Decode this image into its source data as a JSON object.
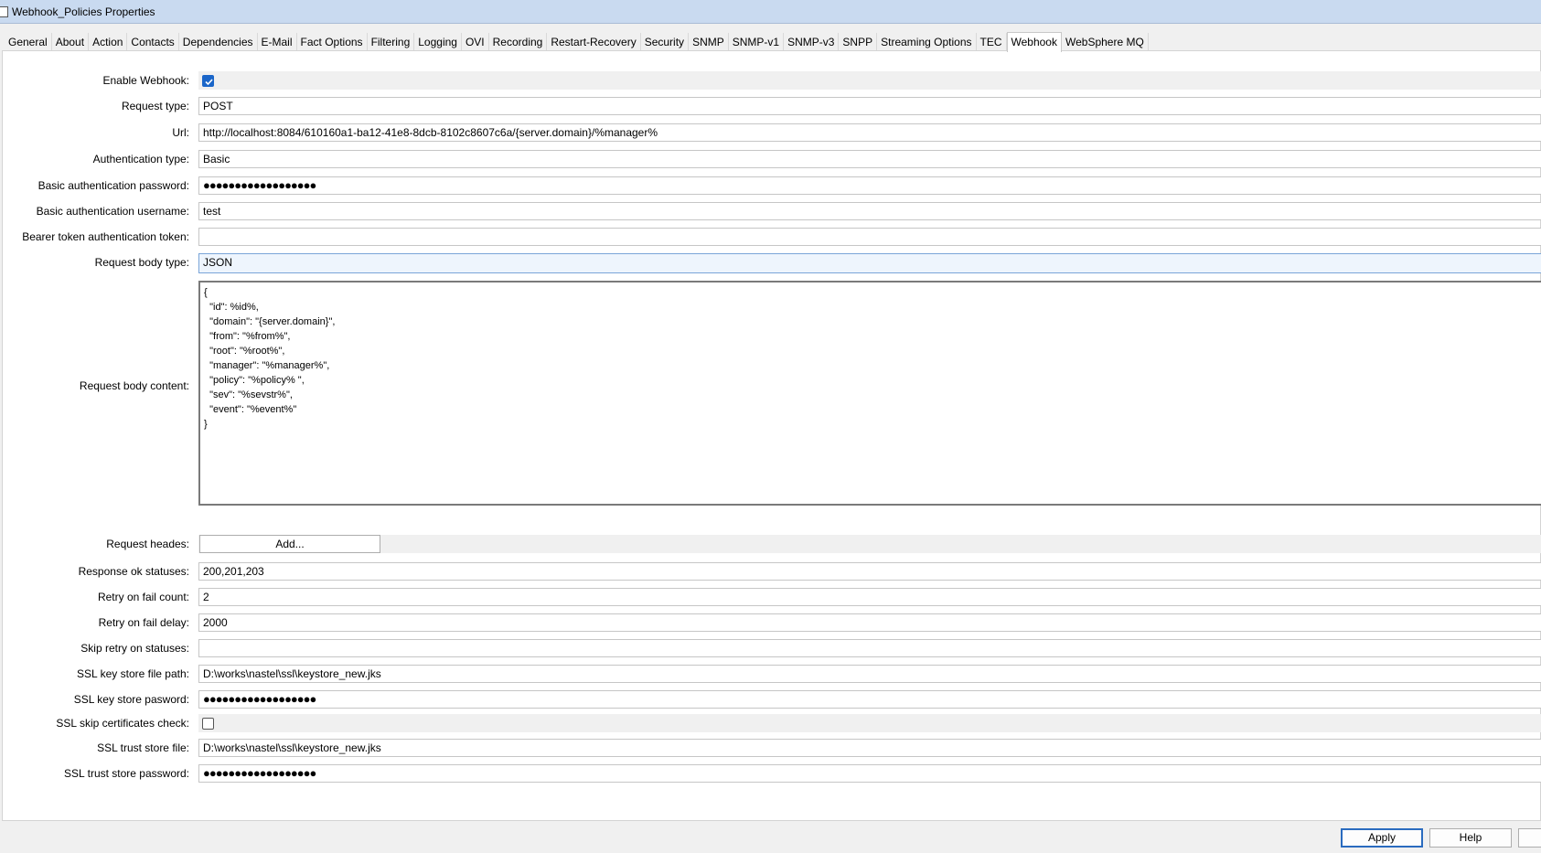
{
  "window": {
    "title": "Webhook_Policies Properties"
  },
  "tabs": [
    "General",
    "About",
    "Action",
    "Contacts",
    "Dependencies",
    "E-Mail",
    "Fact Options",
    "Filtering",
    "Logging",
    "OVI",
    "Recording",
    "Restart-Recovery",
    "Security",
    "SNMP",
    "SNMP-v1",
    "SNMP-v3",
    "SNPP",
    "Streaming Options",
    "TEC",
    "Webhook",
    "WebSphere MQ"
  ],
  "active_tab": "Webhook",
  "form": {
    "enable_webhook": {
      "label": "Enable Webhook:",
      "checked": true
    },
    "request_type": {
      "label": "Request type:",
      "value": "POST"
    },
    "url": {
      "label": "Url:",
      "value": "http://localhost:8084/610160a1-ba12-41e8-8dcb-8102c8607c6a/{server.domain}/%manager%"
    },
    "auth_type": {
      "label": "Authentication type:",
      "value": "Basic"
    },
    "basic_password": {
      "label": "Basic authentication password:",
      "value": "●●●●●●●●●●●●●●●●●●"
    },
    "basic_username": {
      "label": "Basic authentication username:",
      "value": "test"
    },
    "bearer_token": {
      "label": "Bearer token authentication token:",
      "value": ""
    },
    "body_type": {
      "label": "Request body  type:",
      "value": "JSON"
    },
    "body_content": {
      "label": "Request body content:",
      "value": "{\n  \"id\": %id%,\n  \"domain\": \"{server.domain}\",\n  \"from\": \"%from%\",\n  \"root\": \"%root%\",\n  \"manager\": \"%manager%\",\n  \"policy\": \"%policy% \",\n  \"sev\": \"%sevstr%\",\n  \"event\": \"%event%\"\n}"
    },
    "request_headers": {
      "label": "Request heades:",
      "button": "Add..."
    },
    "ok_statuses": {
      "label": "Response ok statuses:",
      "value": "200,201,203"
    },
    "retry_count": {
      "label": "Retry on fail count:",
      "value": "2"
    },
    "retry_delay": {
      "label": "Retry on fail delay:",
      "value": "2000"
    },
    "skip_retry": {
      "label": "Skip retry on statuses:",
      "value": ""
    },
    "ssl_keystore_path": {
      "label": "SSL key store file path:",
      "value": "D:\\works\\nastel\\ssl\\keystore_new.jks"
    },
    "ssl_keystore_password": {
      "label": "SSL key store pasword:",
      "value": "●●●●●●●●●●●●●●●●●●"
    },
    "ssl_skip_check": {
      "label": "SSL skip certificates check:",
      "checked": false
    },
    "ssl_truststore_file": {
      "label": "SSL trust store file:",
      "value": "D:\\works\\nastel\\ssl\\keystore_new.jks"
    },
    "ssl_truststore_password": {
      "label": "SSL trust store password:",
      "value": "●●●●●●●●●●●●●●●●●●"
    }
  },
  "buttons": {
    "apply": "Apply",
    "help": "Help"
  },
  "colors": {
    "titlebar": "#c9daf0",
    "accent": "#1b66c9"
  }
}
